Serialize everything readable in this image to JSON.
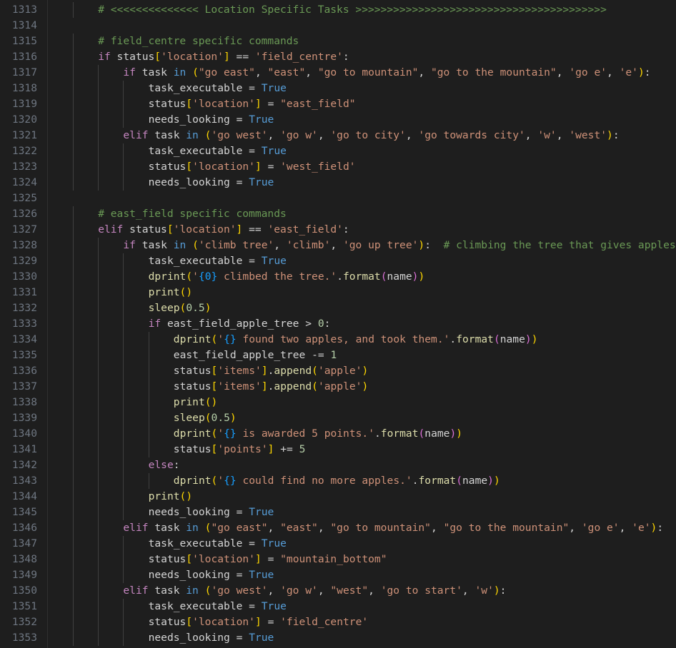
{
  "editor": {
    "colors": {
      "background": "#1e1e1e",
      "line_number": "#6e7681",
      "comment": "#6a9955",
      "keyword": "#c586c0",
      "operator_keyword": "#569cd6",
      "constant": "#569cd6",
      "string": "#ce9178",
      "number": "#b5cea8",
      "text": "#d4d4d4",
      "function": "#dcdcaa",
      "bracket_1": "#ffd700",
      "bracket_2": "#da70d6",
      "bracket_3": "#179fff"
    },
    "lines": [
      {
        "n": "1313",
        "indent": 1,
        "tokens": [
          [
            "c",
            "# <<<<<<<<<<<<<< Location Specific Tasks >>>>>>>>>>>>>>>>>>>>>>>>>>>>>>>>>>>>>>>>"
          ]
        ]
      },
      {
        "n": "1314",
        "indent": 0,
        "tokens": []
      },
      {
        "n": "1315",
        "indent": 1,
        "tokens": [
          [
            "c",
            "# field_centre specific commands"
          ]
        ]
      },
      {
        "n": "1316",
        "indent": 1,
        "tokens": [
          [
            "k",
            "if"
          ],
          [
            "t",
            " status"
          ],
          [
            "b1",
            "["
          ],
          [
            "s",
            "'location'"
          ],
          [
            "b1",
            "]"
          ],
          [
            "t",
            " == "
          ],
          [
            "s",
            "'field_centre'"
          ],
          [
            "t",
            ":"
          ]
        ]
      },
      {
        "n": "1317",
        "indent": 2,
        "tokens": [
          [
            "k",
            "if"
          ],
          [
            "t",
            " task "
          ],
          [
            "o",
            "in"
          ],
          [
            "t",
            " "
          ],
          [
            "b1",
            "("
          ],
          [
            "s",
            "\"go east\""
          ],
          [
            "t",
            ", "
          ],
          [
            "s",
            "\"east\""
          ],
          [
            "t",
            ", "
          ],
          [
            "s",
            "\"go to mountain\""
          ],
          [
            "t",
            ", "
          ],
          [
            "s",
            "\"go to the mountain\""
          ],
          [
            "t",
            ", "
          ],
          [
            "s",
            "'go e'"
          ],
          [
            "t",
            ", "
          ],
          [
            "s",
            "'e'"
          ],
          [
            "b1",
            ")"
          ],
          [
            "t",
            ":"
          ]
        ]
      },
      {
        "n": "1318",
        "indent": 3,
        "tokens": [
          [
            "t",
            "task_executable = "
          ],
          [
            "cn",
            "True"
          ]
        ]
      },
      {
        "n": "1319",
        "indent": 3,
        "tokens": [
          [
            "t",
            "status"
          ],
          [
            "b1",
            "["
          ],
          [
            "s",
            "'location'"
          ],
          [
            "b1",
            "]"
          ],
          [
            "t",
            " = "
          ],
          [
            "s",
            "\"east_field\""
          ]
        ]
      },
      {
        "n": "1320",
        "indent": 3,
        "tokens": [
          [
            "t",
            "needs_looking = "
          ],
          [
            "cn",
            "True"
          ]
        ]
      },
      {
        "n": "1321",
        "indent": 2,
        "tokens": [
          [
            "k",
            "elif"
          ],
          [
            "t",
            " task "
          ],
          [
            "o",
            "in"
          ],
          [
            "t",
            " "
          ],
          [
            "b1",
            "("
          ],
          [
            "s",
            "'go west'"
          ],
          [
            "t",
            ", "
          ],
          [
            "s",
            "'go w'"
          ],
          [
            "t",
            ", "
          ],
          [
            "s",
            "'go to city'"
          ],
          [
            "t",
            ", "
          ],
          [
            "s",
            "'go towards city'"
          ],
          [
            "t",
            ", "
          ],
          [
            "s",
            "'w'"
          ],
          [
            "t",
            ", "
          ],
          [
            "s",
            "'west'"
          ],
          [
            "b1",
            ")"
          ],
          [
            "t",
            ":"
          ]
        ]
      },
      {
        "n": "1322",
        "indent": 3,
        "tokens": [
          [
            "t",
            "task_executable = "
          ],
          [
            "cn",
            "True"
          ]
        ]
      },
      {
        "n": "1323",
        "indent": 3,
        "tokens": [
          [
            "t",
            "status"
          ],
          [
            "b1",
            "["
          ],
          [
            "s",
            "'location'"
          ],
          [
            "b1",
            "]"
          ],
          [
            "t",
            " = "
          ],
          [
            "s",
            "'west_field'"
          ]
        ]
      },
      {
        "n": "1324",
        "indent": 3,
        "tokens": [
          [
            "t",
            "needs_looking = "
          ],
          [
            "cn",
            "True"
          ]
        ]
      },
      {
        "n": "1325",
        "indent": 0,
        "tokens": []
      },
      {
        "n": "1326",
        "indent": 1,
        "tokens": [
          [
            "c",
            "# east_field specific commands"
          ]
        ]
      },
      {
        "n": "1327",
        "indent": 1,
        "tokens": [
          [
            "k",
            "elif"
          ],
          [
            "t",
            " status"
          ],
          [
            "b1",
            "["
          ],
          [
            "s",
            "'location'"
          ],
          [
            "b1",
            "]"
          ],
          [
            "t",
            " == "
          ],
          [
            "s",
            "'east_field'"
          ],
          [
            "t",
            ":"
          ]
        ]
      },
      {
        "n": "1328",
        "indent": 2,
        "tokens": [
          [
            "k",
            "if"
          ],
          [
            "t",
            " task "
          ],
          [
            "o",
            "in"
          ],
          [
            "t",
            " "
          ],
          [
            "b1",
            "("
          ],
          [
            "s",
            "'climb tree'"
          ],
          [
            "t",
            ", "
          ],
          [
            "s",
            "'climb'"
          ],
          [
            "t",
            ", "
          ],
          [
            "s",
            "'go up tree'"
          ],
          [
            "b1",
            ")"
          ],
          [
            "t",
            ":  "
          ],
          [
            "c",
            "# climbing the tree that gives apples"
          ]
        ]
      },
      {
        "n": "1329",
        "indent": 3,
        "tokens": [
          [
            "t",
            "task_executable = "
          ],
          [
            "cn",
            "True"
          ]
        ]
      },
      {
        "n": "1330",
        "indent": 3,
        "tokens": [
          [
            "f",
            "dprint"
          ],
          [
            "b1",
            "("
          ],
          [
            "s",
            "'"
          ],
          [
            "b3",
            "{0}"
          ],
          [
            "s",
            " climbed the tree.'"
          ],
          [
            "t",
            "."
          ],
          [
            "f",
            "format"
          ],
          [
            "b2",
            "("
          ],
          [
            "t",
            "name"
          ],
          [
            "b2",
            ")"
          ],
          [
            "b1",
            ")"
          ]
        ]
      },
      {
        "n": "1331",
        "indent": 3,
        "tokens": [
          [
            "f",
            "print"
          ],
          [
            "b1",
            "()"
          ]
        ]
      },
      {
        "n": "1332",
        "indent": 3,
        "tokens": [
          [
            "f",
            "sleep"
          ],
          [
            "b1",
            "("
          ],
          [
            "nm",
            "0.5"
          ],
          [
            "b1",
            ")"
          ]
        ]
      },
      {
        "n": "1333",
        "indent": 3,
        "tokens": [
          [
            "k",
            "if"
          ],
          [
            "t",
            " east_field_apple_tree > "
          ],
          [
            "nm",
            "0"
          ],
          [
            "t",
            ":"
          ]
        ]
      },
      {
        "n": "1334",
        "indent": 4,
        "tokens": [
          [
            "f",
            "dprint"
          ],
          [
            "b1",
            "("
          ],
          [
            "s",
            "'"
          ],
          [
            "b3",
            "{}"
          ],
          [
            "s",
            " found two apples, and took them.'"
          ],
          [
            "t",
            "."
          ],
          [
            "f",
            "format"
          ],
          [
            "b2",
            "("
          ],
          [
            "t",
            "name"
          ],
          [
            "b2",
            ")"
          ],
          [
            "b1",
            ")"
          ]
        ]
      },
      {
        "n": "1335",
        "indent": 4,
        "tokens": [
          [
            "t",
            "east_field_apple_tree -= "
          ],
          [
            "nm",
            "1"
          ]
        ]
      },
      {
        "n": "1336",
        "indent": 4,
        "tokens": [
          [
            "t",
            "status"
          ],
          [
            "b1",
            "["
          ],
          [
            "s",
            "'items'"
          ],
          [
            "b1",
            "]"
          ],
          [
            "t",
            "."
          ],
          [
            "f",
            "append"
          ],
          [
            "b1",
            "("
          ],
          [
            "s",
            "'apple'"
          ],
          [
            "b1",
            ")"
          ]
        ]
      },
      {
        "n": "1337",
        "indent": 4,
        "tokens": [
          [
            "t",
            "status"
          ],
          [
            "b1",
            "["
          ],
          [
            "s",
            "'items'"
          ],
          [
            "b1",
            "]"
          ],
          [
            "t",
            "."
          ],
          [
            "f",
            "append"
          ],
          [
            "b1",
            "("
          ],
          [
            "s",
            "'apple'"
          ],
          [
            "b1",
            ")"
          ]
        ]
      },
      {
        "n": "1338",
        "indent": 4,
        "tokens": [
          [
            "f",
            "print"
          ],
          [
            "b1",
            "()"
          ]
        ]
      },
      {
        "n": "1339",
        "indent": 4,
        "tokens": [
          [
            "f",
            "sleep"
          ],
          [
            "b1",
            "("
          ],
          [
            "nm",
            "0.5"
          ],
          [
            "b1",
            ")"
          ]
        ]
      },
      {
        "n": "1340",
        "indent": 4,
        "tokens": [
          [
            "f",
            "dprint"
          ],
          [
            "b1",
            "("
          ],
          [
            "s",
            "'"
          ],
          [
            "b3",
            "{}"
          ],
          [
            "s",
            " is awarded 5 points.'"
          ],
          [
            "t",
            "."
          ],
          [
            "f",
            "format"
          ],
          [
            "b2",
            "("
          ],
          [
            "t",
            "name"
          ],
          [
            "b2",
            ")"
          ],
          [
            "b1",
            ")"
          ]
        ]
      },
      {
        "n": "1341",
        "indent": 4,
        "tokens": [
          [
            "t",
            "status"
          ],
          [
            "b1",
            "["
          ],
          [
            "s",
            "'points'"
          ],
          [
            "b1",
            "]"
          ],
          [
            "t",
            " += "
          ],
          [
            "nm",
            "5"
          ]
        ]
      },
      {
        "n": "1342",
        "indent": 3,
        "tokens": [
          [
            "k",
            "else"
          ],
          [
            "t",
            ":"
          ]
        ]
      },
      {
        "n": "1343",
        "indent": 4,
        "tokens": [
          [
            "f",
            "dprint"
          ],
          [
            "b1",
            "("
          ],
          [
            "s",
            "'"
          ],
          [
            "b3",
            "{}"
          ],
          [
            "s",
            " could find no more apples.'"
          ],
          [
            "t",
            "."
          ],
          [
            "f",
            "format"
          ],
          [
            "b2",
            "("
          ],
          [
            "t",
            "name"
          ],
          [
            "b2",
            ")"
          ],
          [
            "b1",
            ")"
          ]
        ]
      },
      {
        "n": "1344",
        "indent": 3,
        "tokens": [
          [
            "f",
            "print"
          ],
          [
            "b1",
            "()"
          ]
        ]
      },
      {
        "n": "1345",
        "indent": 3,
        "tokens": [
          [
            "t",
            "needs_looking = "
          ],
          [
            "cn",
            "True"
          ]
        ]
      },
      {
        "n": "1346",
        "indent": 2,
        "tokens": [
          [
            "k",
            "elif"
          ],
          [
            "t",
            " task "
          ],
          [
            "o",
            "in"
          ],
          [
            "t",
            " "
          ],
          [
            "b1",
            "("
          ],
          [
            "s",
            "\"go east\""
          ],
          [
            "t",
            ", "
          ],
          [
            "s",
            "\"east\""
          ],
          [
            "t",
            ", "
          ],
          [
            "s",
            "\"go to mountain\""
          ],
          [
            "t",
            ", "
          ],
          [
            "s",
            "\"go to the mountain\""
          ],
          [
            "t",
            ", "
          ],
          [
            "s",
            "'go e'"
          ],
          [
            "t",
            ", "
          ],
          [
            "s",
            "'e'"
          ],
          [
            "b1",
            ")"
          ],
          [
            "t",
            ":"
          ]
        ]
      },
      {
        "n": "1347",
        "indent": 3,
        "tokens": [
          [
            "t",
            "task_executable = "
          ],
          [
            "cn",
            "True"
          ]
        ]
      },
      {
        "n": "1348",
        "indent": 3,
        "tokens": [
          [
            "t",
            "status"
          ],
          [
            "b1",
            "["
          ],
          [
            "s",
            "'location'"
          ],
          [
            "b1",
            "]"
          ],
          [
            "t",
            " = "
          ],
          [
            "s",
            "\"mountain_bottom\""
          ]
        ]
      },
      {
        "n": "1349",
        "indent": 3,
        "tokens": [
          [
            "t",
            "needs_looking = "
          ],
          [
            "cn",
            "True"
          ]
        ]
      },
      {
        "n": "1350",
        "indent": 2,
        "tokens": [
          [
            "k",
            "elif"
          ],
          [
            "t",
            " task "
          ],
          [
            "o",
            "in"
          ],
          [
            "t",
            " "
          ],
          [
            "b1",
            "("
          ],
          [
            "s",
            "'go west'"
          ],
          [
            "t",
            ", "
          ],
          [
            "s",
            "'go w'"
          ],
          [
            "t",
            ", "
          ],
          [
            "s",
            "\"west\""
          ],
          [
            "t",
            ", "
          ],
          [
            "s",
            "'go to start'"
          ],
          [
            "t",
            ", "
          ],
          [
            "s",
            "'w'"
          ],
          [
            "b1",
            ")"
          ],
          [
            "t",
            ":"
          ]
        ]
      },
      {
        "n": "1351",
        "indent": 3,
        "tokens": [
          [
            "t",
            "task_executable = "
          ],
          [
            "cn",
            "True"
          ]
        ]
      },
      {
        "n": "1352",
        "indent": 3,
        "tokens": [
          [
            "t",
            "status"
          ],
          [
            "b1",
            "["
          ],
          [
            "s",
            "'location'"
          ],
          [
            "b1",
            "]"
          ],
          [
            "t",
            " = "
          ],
          [
            "s",
            "'field_centre'"
          ]
        ]
      },
      {
        "n": "1353",
        "indent": 3,
        "tokens": [
          [
            "t",
            "needs_looking = "
          ],
          [
            "cn",
            "True"
          ]
        ]
      }
    ]
  }
}
